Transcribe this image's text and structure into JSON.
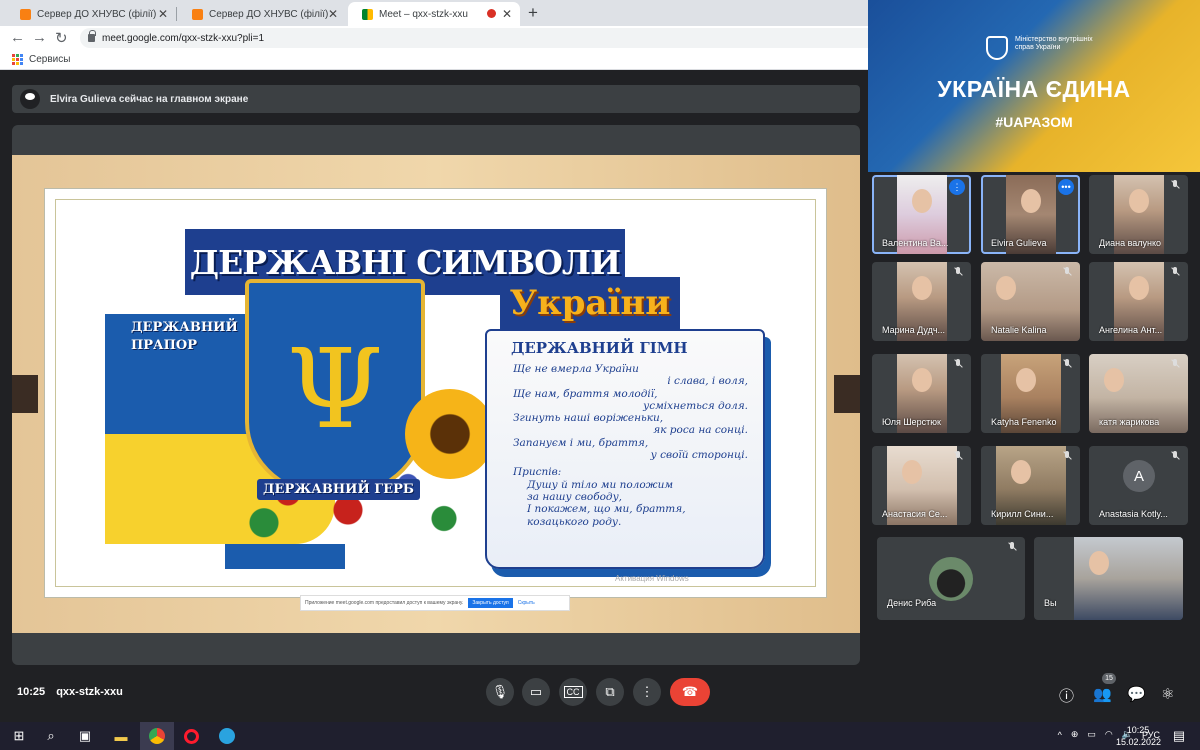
{
  "browser": {
    "tabs": [
      {
        "title": "Сервер ДО ХНУВС (філії)",
        "active": false
      },
      {
        "title": "Сервер ДО ХНУВС (філії)",
        "active": false
      },
      {
        "title": "Meet – qxx-stzk-xxu",
        "active": true
      }
    ],
    "url": "meet.google.com/qxx-stzk-xxu?pli=1",
    "bookmark_label": "Сервисы"
  },
  "presenter_notice": "Elvira Gulieva сейчас на главном экране",
  "slide": {
    "title_line1": "ДЕРЖАВНІ СИМВОЛИ",
    "title_line2": "України",
    "flag_label_line1": "ДЕРЖАВНИЙ",
    "flag_label_line2": "ПРАПОР",
    "coat_label": "ДЕРЖАВНИЙ ГЕРБ",
    "trident_glyph": "Ψ",
    "anthem_title": "ДЕРЖАВНИЙ ГІМН",
    "anthem_lines": [
      {
        "text": "Ще не вмерла України",
        "align": "left"
      },
      {
        "text": "і слава, і воля,",
        "align": "right"
      },
      {
        "text": "Ще нам, браття молодії,",
        "align": "left"
      },
      {
        "text": "усміхнеться доля.",
        "align": "right"
      },
      {
        "text": "Згинуть наші воріженьки,",
        "align": "left"
      },
      {
        "text": "як роса на сонці.",
        "align": "right"
      },
      {
        "text": "Запануєм і ми, браття,",
        "align": "left"
      },
      {
        "text": "у своїй сторонці.",
        "align": "right"
      },
      {
        "text": "Приспів:",
        "align": "left"
      },
      {
        "text": "Душу й тіло ми положим",
        "align": "left"
      },
      {
        "text": "за нашу свободу,",
        "align": "left"
      },
      {
        "text": "І покажем, що ми, браття,",
        "align": "left"
      },
      {
        "text": "козацького роду.",
        "align": "left"
      }
    ],
    "watermark": "Активация Windows",
    "share_notice": "Приложение meet.google.com предоставил доступ к вашему экрану.",
    "share_stop": "Закрыть доступ",
    "share_hide": "Скрыть"
  },
  "banner": {
    "ministry": "Міністерство внутрішніх справ України",
    "headline": "УКРАЇНА ЄДИНА",
    "hashtag": "#UAРАЗОМ"
  },
  "participants": [
    {
      "name": "Валентина Ва...",
      "muted": false,
      "speaking": true
    },
    {
      "name": "Elvira Gulieva",
      "muted": false,
      "speaking": false,
      "highlight": true
    },
    {
      "name": "Диана валунко",
      "muted": true
    },
    {
      "name": "Марина Дудч...",
      "muted": true
    },
    {
      "name": "Natalie Kalina",
      "muted": true
    },
    {
      "name": "Ангелина Ант...",
      "muted": true
    },
    {
      "name": "Юля Шерстюк",
      "muted": true
    },
    {
      "name": "Katyha Fenenko",
      "muted": true
    },
    {
      "name": "катя жарикова",
      "muted": true
    },
    {
      "name": "Анастасия Се...",
      "muted": true
    },
    {
      "name": "Кирилл Сини...",
      "muted": true
    },
    {
      "name": "Anastasia Kotly...",
      "muted": true,
      "avatar_letter": "A"
    },
    {
      "name": "Денис Риба",
      "muted": true
    },
    {
      "name": "Вы",
      "muted": false
    }
  ],
  "meeting": {
    "time": "10:25",
    "code": "qxx-stzk-xxu",
    "participant_count": "15"
  },
  "taskbar": {
    "lang": "РУС",
    "clock_time": "10:25",
    "clock_date": "15.02.2022"
  },
  "colors": {
    "meet_bg": "#202124",
    "end_call": "#ea4335",
    "accent_blue": "#1a73e8",
    "ukraine_blue": "#1b5cad",
    "ukraine_yellow": "#f7d12d"
  }
}
